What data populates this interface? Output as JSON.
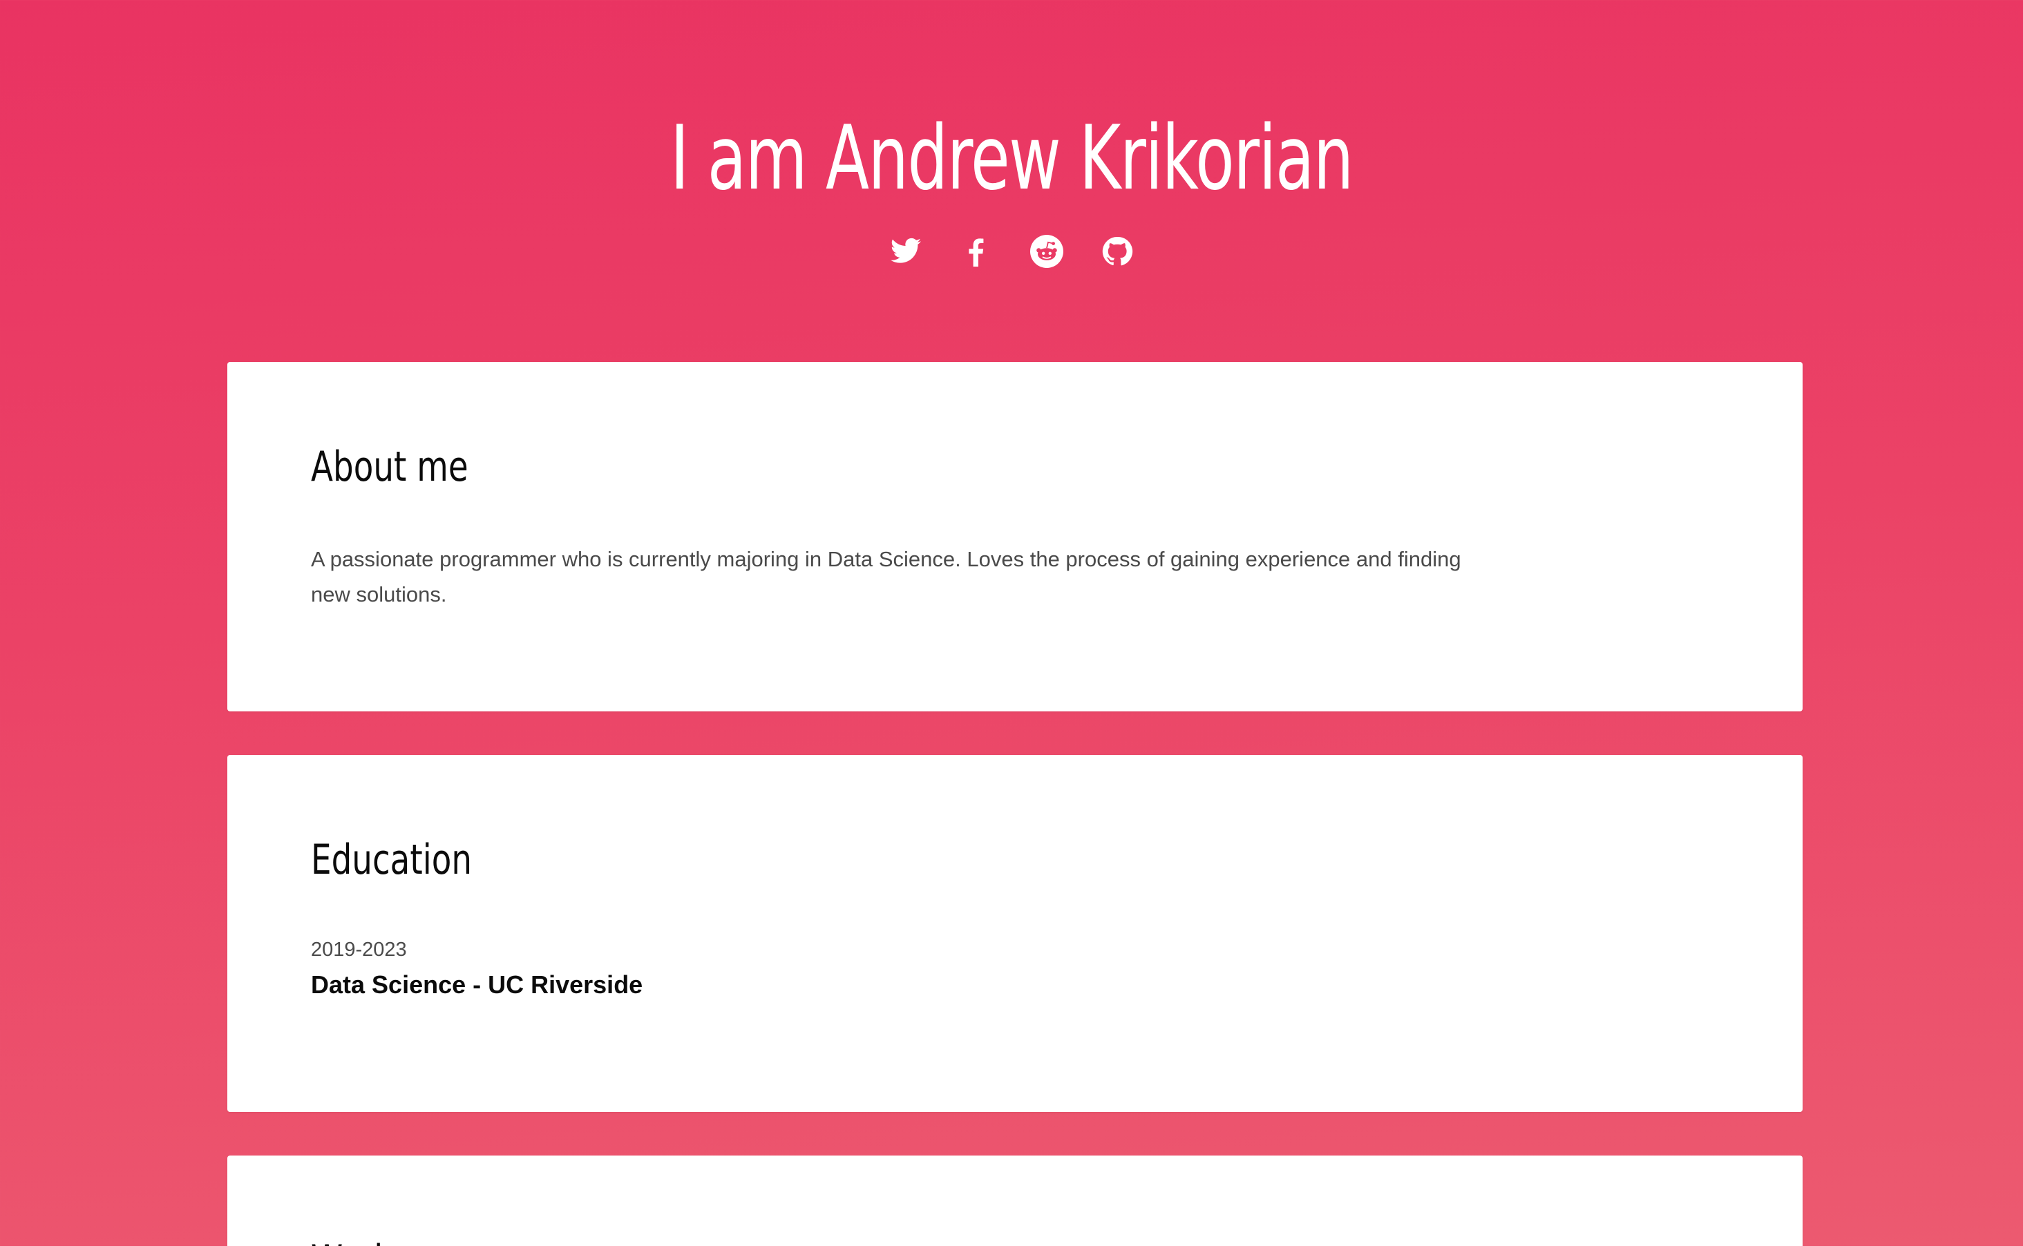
{
  "header": {
    "title": "I am Andrew Krikorian",
    "social": [
      {
        "icon": "twitter-icon"
      },
      {
        "icon": "facebook-icon"
      },
      {
        "icon": "reddit-icon"
      },
      {
        "icon": "github-icon"
      }
    ]
  },
  "about": {
    "heading": "About me",
    "text": "A passionate programmer who is currently majoring in Data Science. Loves the process of gaining experience and finding new solutions."
  },
  "education": {
    "heading": "Education",
    "items": [
      {
        "years": "2019-2023",
        "degree": "Data Science - UC Riverside"
      }
    ]
  },
  "work": {
    "heading": "Work"
  },
  "colors": {
    "background_top": "#e93362",
    "background_bottom": "#ec5a70",
    "card": "#ffffff",
    "heading_text": "#0b0b0b",
    "body_text": "#4a4a4a"
  }
}
